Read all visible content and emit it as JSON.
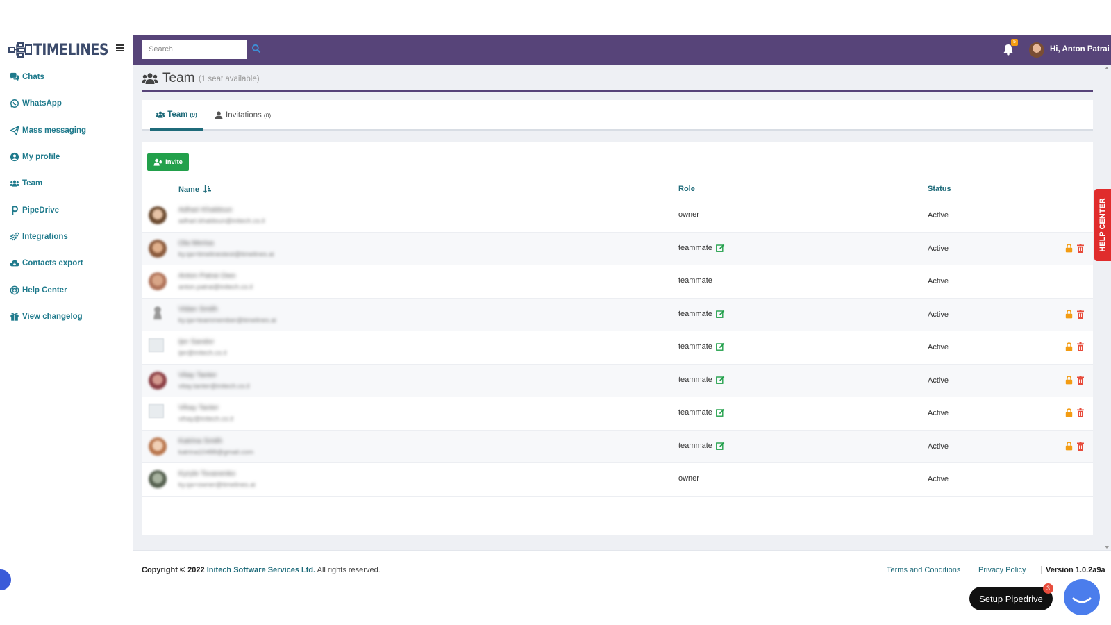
{
  "brand": {
    "name": "TIMELINES"
  },
  "sidebar": {
    "items": [
      {
        "label": "Chats",
        "icon": "chats-icon"
      },
      {
        "label": "WhatsApp",
        "icon": "whatsapp-icon"
      },
      {
        "label": "Mass messaging",
        "icon": "paper-plane-icon"
      },
      {
        "label": "My profile",
        "icon": "user-circle-icon"
      },
      {
        "label": "Team",
        "icon": "users-icon"
      },
      {
        "label": "PipeDrive",
        "icon": "pipedrive-icon"
      },
      {
        "label": "Integrations",
        "icon": "cogs-icon"
      },
      {
        "label": "Contacts export",
        "icon": "cloud-download-icon"
      },
      {
        "label": "Help Center",
        "icon": "life-ring-icon"
      },
      {
        "label": "View changelog",
        "icon": "gift-icon"
      }
    ]
  },
  "topbar": {
    "search_placeholder": "Search",
    "notification_count": "5",
    "greeting": "Hi, Anton Patrai"
  },
  "page": {
    "title": "Team",
    "subtitle": "(1 seat available)"
  },
  "tabs": [
    {
      "label": "Team",
      "count": "(9)"
    },
    {
      "label": "Invitations",
      "count": "(0)"
    }
  ],
  "invite_label": "Invite",
  "table": {
    "headers": {
      "name": "Name",
      "role": "Role",
      "status": "Status"
    },
    "rows": [
      {
        "name": "Adhari Khaldoun",
        "email": "adhari.khaldoun@initech.co.il",
        "role": "owner",
        "status": "Active"
      },
      {
        "name": "Ola Merisa",
        "email": "ky.qa+timelinestest@timelines.ai",
        "role": "teammate",
        "status": "Active"
      },
      {
        "name": "Anton Patrai Owo",
        "email": "anton.patrai@initech.co.il",
        "role": "teammate",
        "status": "Active"
      },
      {
        "name": "Vidan Smith",
        "email": "ky.qa+teammember@timelines.ai",
        "role": "teammate",
        "status": "Active"
      },
      {
        "name": "Ijer Sandor",
        "email": "ijer@initech.co.il",
        "role": "teammate",
        "status": "Active"
      },
      {
        "name": "Vitay Tanter",
        "email": "vitay.tanter@initech.co.il",
        "role": "teammate",
        "status": "Active"
      },
      {
        "name": "Vihay Tanter",
        "email": "vihay@initech.co.il",
        "role": "teammate",
        "status": "Active"
      },
      {
        "name": "Katrina Smith",
        "email": "katrina10488@gmail.com",
        "role": "teammate",
        "status": "Active"
      },
      {
        "name": "Kyryle Tsvanenko",
        "email": "ky.qa+owner@timelines.ai",
        "role": "owner",
        "status": "Active"
      }
    ]
  },
  "help_center_tab": "HELP CENTER",
  "footer": {
    "copyright_prefix": "Copyright © 2022",
    "company": "Initech Software Services Ltd.",
    "rights": "All rights reserved.",
    "terms": "Terms and Conditions",
    "privacy": "Privacy Policy",
    "version": "Version 1.0.2a9a"
  },
  "setup_pipedrive": {
    "label": "Setup Pipedrive",
    "badge": "3"
  },
  "colors": {
    "topbar": "#574479",
    "accent": "#1f6b7a",
    "invite": "#22a04b",
    "help_tab": "#e02c2c",
    "lock": "#f39c12",
    "trash": "#e74c3c"
  }
}
